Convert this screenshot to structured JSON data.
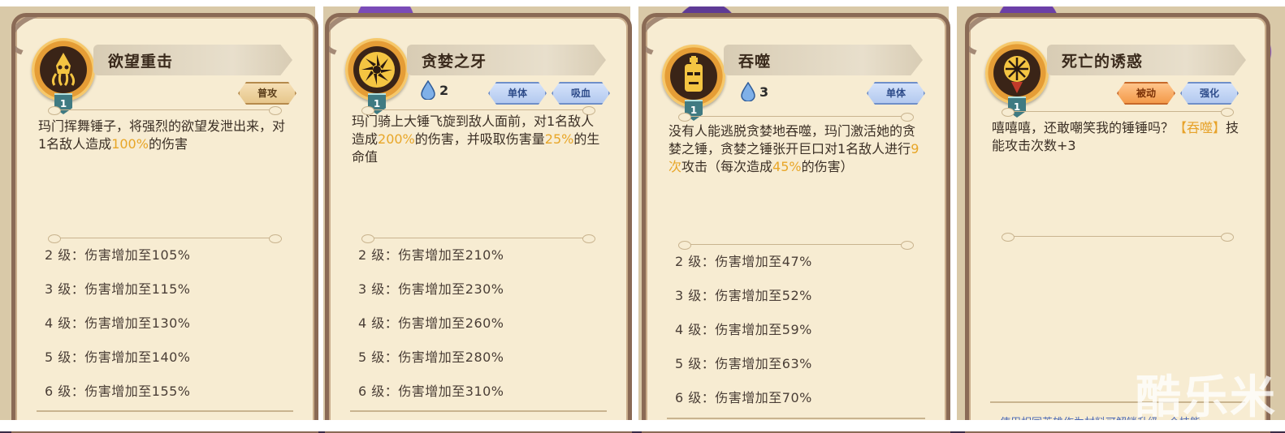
{
  "panels": [
    {
      "title": "欲望重击",
      "level": "1",
      "mana": "",
      "tags": [
        "普攻"
      ],
      "desc_parts": [
        "玛门挥舞锤子，将强烈的欲望发泄出来，对1名敌人造成",
        "100%",
        "的伤害"
      ],
      "levels": [
        "2 级：伤害增加至105%",
        "3 级：伤害增加至115%",
        "4 级：伤害增加至130%",
        "5 级：伤害增加至140%",
        "6 级：伤害增加至155%"
      ]
    },
    {
      "title": "贪婪之牙",
      "level": "1",
      "mana": "2",
      "tags": [
        "单体",
        "吸血"
      ],
      "desc_parts": [
        "玛门骑上大锤飞旋到敌人面前，对1名敌人造成",
        "200%",
        "的伤害，并吸取伤害量",
        "25%",
        "的生命值"
      ],
      "levels": [
        "2 级：伤害增加至210%",
        "3 级：伤害增加至230%",
        "4 级：伤害增加至260%",
        "5 级：伤害增加至280%",
        "6 级：伤害增加至310%"
      ]
    },
    {
      "title": "吞噬",
      "level": "1",
      "mana": "3",
      "tags": [
        "单体"
      ],
      "desc_parts": [
        "没有人能逃脱贪婪地吞噬，玛门激活她的贪婪之锤，贪婪之锤张开巨口对1名敌人进行",
        "9次",
        "攻击（每次造成",
        "45%",
        "的伤害）"
      ],
      "levels": [
        "2 级：伤害增加至47%",
        "3 级：伤害增加至52%",
        "4 级：伤害增加至59%",
        "5 级：伤害增加至63%",
        "6 级：伤害增加至70%"
      ]
    },
    {
      "title": "死亡的诱惑",
      "level": "1",
      "mana": "",
      "tags": [
        "被动",
        "强化"
      ],
      "desc_parts": [
        "嘻嘻嘻，还敢嘲笑我的锤锤吗？",
        "【吞噬】",
        "技能攻击次数+3"
      ],
      "footer": "使用相同英雄作为材料可解锁升级一个技能",
      "levels": []
    }
  ],
  "watermark": "酷乐米"
}
